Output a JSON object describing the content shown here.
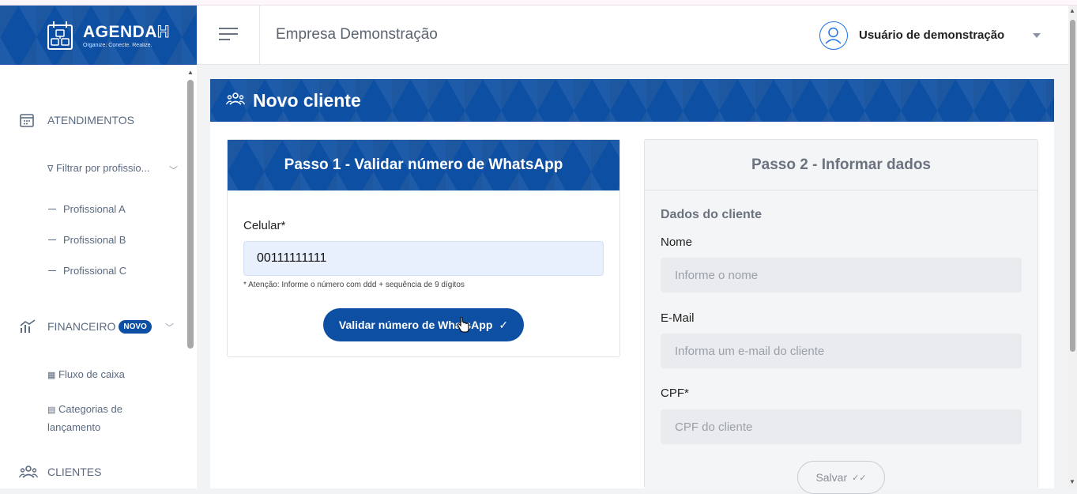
{
  "brand": {
    "name_bold": "AGENDA",
    "name_outline": "H",
    "tagline": "Organize. Conecte. Realize."
  },
  "sidebar": {
    "atendimentos_label": "ATENDIMENTOS",
    "filter_label": "Filtrar por profissio...",
    "professionals": [
      "Profissional A",
      "Profissional B",
      "Profissional C"
    ],
    "financeiro_label": "FINANCEIRO",
    "financeiro_badge": "NOVO",
    "fluxo_label": "Fluxo de caixa",
    "categorias_label_1": "Categorias de",
    "categorias_label_2": "lançamento",
    "clientes_label": "CLIENTES"
  },
  "header": {
    "company": "Empresa Demonstração",
    "user_name": "Usuário de demonstração"
  },
  "page": {
    "title": "Novo cliente"
  },
  "step1": {
    "title": "Passo 1 - Validar número de WhatsApp",
    "phone_label": "Celular*",
    "phone_value": "00111111111",
    "hint": "* Atenção: Informe o número com ddd + sequência de 9 dígitos",
    "validate_label": "Validar número de WhatsApp",
    "validate_icon": "✓"
  },
  "step2": {
    "title": "Passo 2 - Informar dados",
    "section_title": "Dados do cliente",
    "name_label": "Nome",
    "name_placeholder": "Informe o nome",
    "email_label": "E-Mail",
    "email_placeholder": "Informa um e-mail do cliente",
    "cpf_label": "CPF*",
    "cpf_placeholder": "CPF do cliente",
    "save_label": "Salvar",
    "save_icon": "✓✓"
  },
  "colors": {
    "primary": "#0d4fa3",
    "background": "#f1f3f5"
  }
}
